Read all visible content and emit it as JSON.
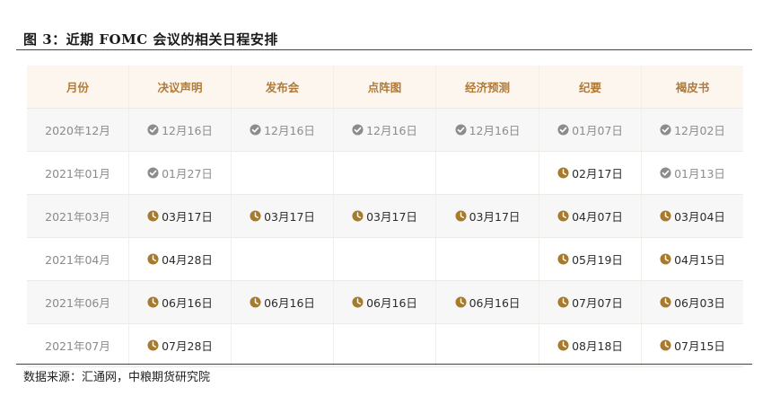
{
  "title": "图 3：近期 FOMC 会议的相关日程安排",
  "source": "数据来源：汇通网，中粮期货研究院",
  "colors": {
    "done": "#8c8c8c",
    "todo": "#a87a2c",
    "header_text": "#b07a3a",
    "header_bg": "#fdf6ee"
  },
  "table": {
    "headers": [
      "月份",
      "决议声明",
      "发布会",
      "点阵图",
      "经济预测",
      "纪要",
      "褐皮书"
    ],
    "rows": [
      {
        "month": "2020年12月",
        "cells": [
          {
            "date": "12月16日",
            "status": "done"
          },
          {
            "date": "12月16日",
            "status": "done"
          },
          {
            "date": "12月16日",
            "status": "done"
          },
          {
            "date": "12月16日",
            "status": "done"
          },
          {
            "date": "01月07日",
            "status": "done"
          },
          {
            "date": "12月02日",
            "status": "done"
          }
        ]
      },
      {
        "month": "2021年01月",
        "cells": [
          {
            "date": "01月27日",
            "status": "done"
          },
          {
            "date": "",
            "status": ""
          },
          {
            "date": "",
            "status": ""
          },
          {
            "date": "",
            "status": ""
          },
          {
            "date": "02月17日",
            "status": "todo"
          },
          {
            "date": "01月13日",
            "status": "done"
          }
        ]
      },
      {
        "month": "2021年03月",
        "cells": [
          {
            "date": "03月17日",
            "status": "todo"
          },
          {
            "date": "03月17日",
            "status": "todo"
          },
          {
            "date": "03月17日",
            "status": "todo"
          },
          {
            "date": "03月17日",
            "status": "todo"
          },
          {
            "date": "04月07日",
            "status": "todo"
          },
          {
            "date": "03月04日",
            "status": "todo"
          }
        ]
      },
      {
        "month": "2021年04月",
        "cells": [
          {
            "date": "04月28日",
            "status": "todo"
          },
          {
            "date": "",
            "status": ""
          },
          {
            "date": "",
            "status": ""
          },
          {
            "date": "",
            "status": ""
          },
          {
            "date": "05月19日",
            "status": "todo"
          },
          {
            "date": "04月15日",
            "status": "todo"
          }
        ]
      },
      {
        "month": "2021年06月",
        "cells": [
          {
            "date": "06月16日",
            "status": "todo"
          },
          {
            "date": "06月16日",
            "status": "todo"
          },
          {
            "date": "06月16日",
            "status": "todo"
          },
          {
            "date": "06月16日",
            "status": "todo"
          },
          {
            "date": "07月07日",
            "status": "todo"
          },
          {
            "date": "06月03日",
            "status": "todo"
          }
        ]
      },
      {
        "month": "2021年07月",
        "cells": [
          {
            "date": "07月28日",
            "status": "todo"
          },
          {
            "date": "",
            "status": ""
          },
          {
            "date": "",
            "status": ""
          },
          {
            "date": "",
            "status": ""
          },
          {
            "date": "08月18日",
            "status": "todo"
          },
          {
            "date": "07月15日",
            "status": "todo"
          }
        ]
      }
    ],
    "icons": {
      "done": "check-circle-icon",
      "todo": "clock-icon"
    }
  }
}
